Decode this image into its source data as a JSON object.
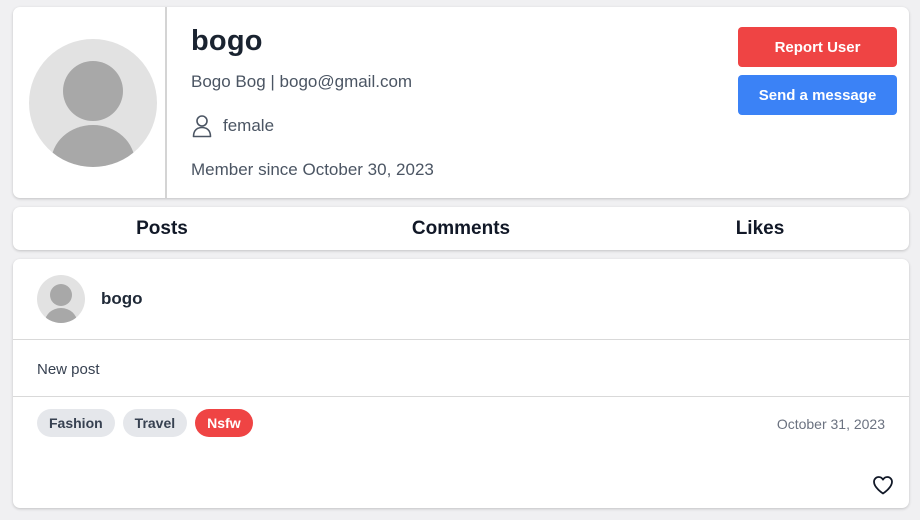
{
  "profile": {
    "username": "bogo",
    "name_email": "Bogo Bog | bogo@gmail.com",
    "gender": "female",
    "member_since": "Member since October 30, 2023",
    "avatar_icon": "user-avatar-icon",
    "gender_icon": "person-icon"
  },
  "actions": {
    "report_label": "Report User",
    "message_label": "Send a message"
  },
  "tabs": [
    {
      "label": "Posts"
    },
    {
      "label": "Comments"
    },
    {
      "label": "Likes"
    }
  ],
  "post": {
    "author": "bogo",
    "content": "New post",
    "tags": [
      {
        "label": "Fashion"
      },
      {
        "label": "Travel"
      },
      {
        "label": "Nsfw"
      }
    ],
    "date": "October 31, 2023",
    "like_icon": "heart-icon"
  },
  "colors": {
    "danger": "#ef4444",
    "primary": "#3b82f6",
    "avatar_bg": "#e2e2e2",
    "avatar_fg": "#a8a8a8"
  }
}
